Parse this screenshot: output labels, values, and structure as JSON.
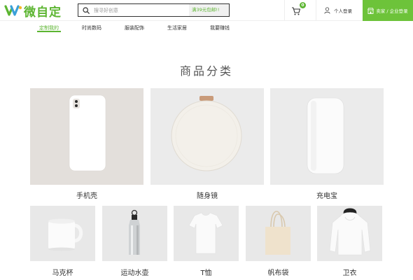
{
  "brand": {
    "logo_text": "微自定",
    "accent": "#5cb531",
    "seller_bg": "#6dc33a"
  },
  "search": {
    "placeholder": "搜寻好创意",
    "promo": "满39元包邮!!"
  },
  "cart": {
    "count": "0",
    "icon": "cart-icon"
  },
  "login": {
    "label": "个人登录",
    "icon": "user-icon"
  },
  "seller": {
    "label": "卖家 / 企业登录",
    "icon": "store-icon"
  },
  "nav": {
    "items": [
      {
        "label": "定制我的"
      },
      {
        "label": "时尚数码"
      },
      {
        "label": "服装配饰"
      },
      {
        "label": "生活家居"
      },
      {
        "label": "我要赚钱"
      }
    ],
    "active_index": 0
  },
  "section": {
    "title": "商品分类"
  },
  "products_top": [
    {
      "label": "手机壳",
      "icon": "phone-case-image",
      "bg": "#e3dfdb"
    },
    {
      "label": "随身镜",
      "icon": "pocket-mirror-image",
      "bg": "#ebebeb"
    },
    {
      "label": "充电宝",
      "icon": "power-bank-image",
      "bg": "#ebebeb"
    }
  ],
  "products_bottom": [
    {
      "label": "马克杯",
      "icon": "mug-image",
      "bg": "#e8e8e8"
    },
    {
      "label": "运动水壶",
      "icon": "sports-bottle-image",
      "bg": "#e8e8e8"
    },
    {
      "label": "T恤",
      "icon": "tshirt-image",
      "bg": "#e8e8e8"
    },
    {
      "label": "帆布袋",
      "icon": "canvas-bag-image",
      "bg": "#e8e8e8"
    },
    {
      "label": "卫衣",
      "icon": "hoodie-image",
      "bg": "#e8e8e8"
    }
  ]
}
